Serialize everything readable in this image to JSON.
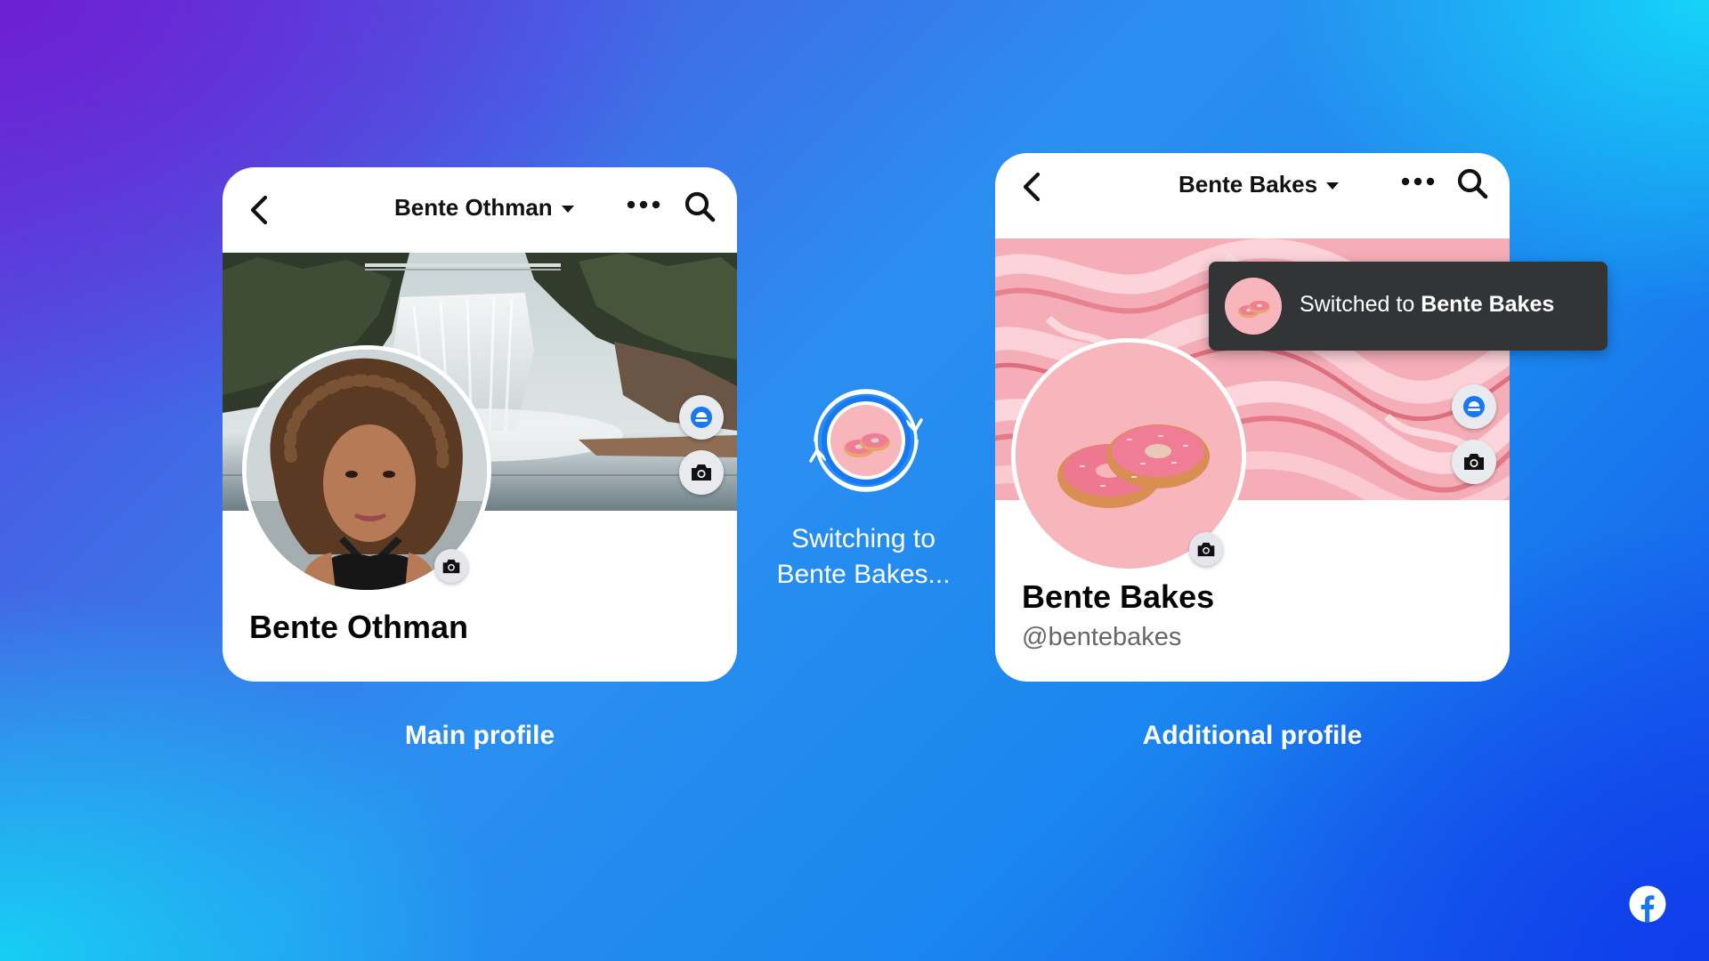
{
  "main_profile": {
    "header_title": "Bente Othman",
    "name": "Bente Othman",
    "caption": "Main profile"
  },
  "switching": {
    "line1": "Switching to",
    "line2": "Bente Bakes..."
  },
  "additional_profile": {
    "header_title": "Bente Bakes",
    "name": "Bente Bakes",
    "handle": "@bentebakes",
    "caption": "Additional profile"
  },
  "toast": {
    "prefix": "Switched to ",
    "name": "Bente Bakes"
  },
  "icons": [
    "back-arrow-icon",
    "more-options-icon",
    "search-icon",
    "avatar-frame-icon",
    "camera-icon",
    "facebook-logo-icon"
  ],
  "colors": {
    "brand_blue": "#1877f2",
    "toast_bg": "#323436",
    "donut_pink": "#f7b6bc"
  }
}
